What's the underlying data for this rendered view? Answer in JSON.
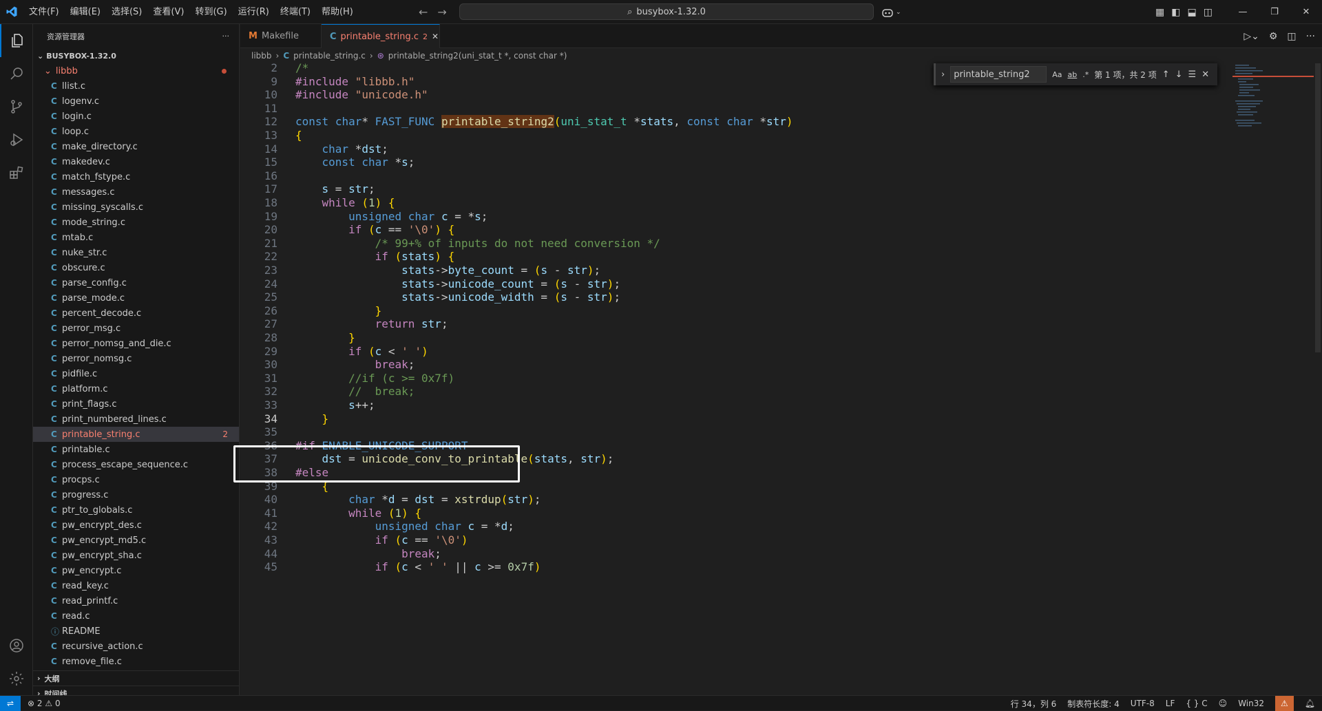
{
  "titlebar": {
    "menu": [
      "文件(F)",
      "编辑(E)",
      "选择(S)",
      "查看(V)",
      "转到(G)",
      "运行(R)",
      "终端(T)",
      "帮助(H)"
    ],
    "search_text": "busybox-1.32.0"
  },
  "sidebar": {
    "title": "资源管理器",
    "more": "···",
    "root": "BUSYBOX-1.32.0",
    "folder": "libbb",
    "files": [
      {
        "icon": "C",
        "name": "llist.c"
      },
      {
        "icon": "C",
        "name": "logenv.c"
      },
      {
        "icon": "C",
        "name": "login.c"
      },
      {
        "icon": "C",
        "name": "loop.c"
      },
      {
        "icon": "C",
        "name": "make_directory.c"
      },
      {
        "icon": "C",
        "name": "makedev.c"
      },
      {
        "icon": "C",
        "name": "match_fstype.c"
      },
      {
        "icon": "C",
        "name": "messages.c"
      },
      {
        "icon": "C",
        "name": "missing_syscalls.c"
      },
      {
        "icon": "C",
        "name": "mode_string.c"
      },
      {
        "icon": "C",
        "name": "mtab.c"
      },
      {
        "icon": "C",
        "name": "nuke_str.c"
      },
      {
        "icon": "C",
        "name": "obscure.c"
      },
      {
        "icon": "C",
        "name": "parse_config.c"
      },
      {
        "icon": "C",
        "name": "parse_mode.c"
      },
      {
        "icon": "C",
        "name": "percent_decode.c"
      },
      {
        "icon": "C",
        "name": "perror_msg.c"
      },
      {
        "icon": "C",
        "name": "perror_nomsg_and_die.c"
      },
      {
        "icon": "C",
        "name": "perror_nomsg.c"
      },
      {
        "icon": "C",
        "name": "pidfile.c"
      },
      {
        "icon": "C",
        "name": "platform.c"
      },
      {
        "icon": "C",
        "name": "print_flags.c"
      },
      {
        "icon": "C",
        "name": "print_numbered_lines.c"
      },
      {
        "icon": "C",
        "name": "printable_string.c",
        "badge": "2",
        "active": true
      },
      {
        "icon": "C",
        "name": "printable.c"
      },
      {
        "icon": "C",
        "name": "process_escape_sequence.c"
      },
      {
        "icon": "C",
        "name": "procps.c"
      },
      {
        "icon": "C",
        "name": "progress.c"
      },
      {
        "icon": "C",
        "name": "ptr_to_globals.c"
      },
      {
        "icon": "C",
        "name": "pw_encrypt_des.c"
      },
      {
        "icon": "C",
        "name": "pw_encrypt_md5.c"
      },
      {
        "icon": "C",
        "name": "pw_encrypt_sha.c"
      },
      {
        "icon": "C",
        "name": "pw_encrypt.c"
      },
      {
        "icon": "C",
        "name": "read_key.c"
      },
      {
        "icon": "C",
        "name": "read_printf.c"
      },
      {
        "icon": "C",
        "name": "read.c"
      },
      {
        "icon": "ⓘ",
        "name": "README"
      },
      {
        "icon": "C",
        "name": "recursive_action.c"
      },
      {
        "icon": "C",
        "name": "remove_file.c"
      }
    ],
    "outline": "大纲",
    "timeline": "时间线"
  },
  "tabs": [
    {
      "icon": "M",
      "label": "Makefile"
    },
    {
      "icon": "C",
      "label": "printable_string.c",
      "badge": "2",
      "close": "✕"
    }
  ],
  "breadcrumb": {
    "folder": "libbb",
    "file": "printable_string.c",
    "symbol": "printable_string2(uni_stat_t *, const char *)"
  },
  "find": {
    "query": "printable_string2",
    "opts": [
      "Aa",
      "ab",
      ".*"
    ],
    "result": "第 1 项，共 2 项"
  },
  "code": [
    {
      "n": "2",
      "t": "/*"
    },
    {
      "n": "9",
      "t": "#include \"libbb.h\""
    },
    {
      "n": "10",
      "t": "#include \"unicode.h\""
    },
    {
      "n": "11",
      "t": ""
    },
    {
      "n": "12",
      "t": "const char* FAST_FUNC printable_string2(uni_stat_t *stats, const char *str)"
    },
    {
      "n": "13",
      "t": "{"
    },
    {
      "n": "14",
      "t": "    char *dst;"
    },
    {
      "n": "15",
      "t": "    const char *s;"
    },
    {
      "n": "16",
      "t": ""
    },
    {
      "n": "17",
      "t": "    s = str;"
    },
    {
      "n": "18",
      "t": "    while (1) {"
    },
    {
      "n": "19",
      "t": "        unsigned char c = *s;"
    },
    {
      "n": "20",
      "t": "        if (c == '\\0') {"
    },
    {
      "n": "21",
      "t": "            /* 99+% of inputs do not need conversion */"
    },
    {
      "n": "22",
      "t": "            if (stats) {"
    },
    {
      "n": "23",
      "t": "                stats->byte_count = (s - str);"
    },
    {
      "n": "24",
      "t": "                stats->unicode_count = (s - str);"
    },
    {
      "n": "25",
      "t": "                stats->unicode_width = (s - str);"
    },
    {
      "n": "26",
      "t": "            }"
    },
    {
      "n": "27",
      "t": "            return str;"
    },
    {
      "n": "28",
      "t": "        }"
    },
    {
      "n": "29",
      "t": "        if (c < ' ')"
    },
    {
      "n": "30",
      "t": "            break;"
    },
    {
      "n": "31",
      "t": "        //if (c >= 0x7f)"
    },
    {
      "n": "32",
      "t": "        //  break;"
    },
    {
      "n": "33",
      "t": "        s++;"
    },
    {
      "n": "34",
      "t": "    }"
    },
    {
      "n": "35",
      "t": ""
    },
    {
      "n": "36",
      "t": "#if ENABLE_UNICODE_SUPPORT"
    },
    {
      "n": "37",
      "t": "    dst = unicode_conv_to_printable(stats, str);"
    },
    {
      "n": "38",
      "t": "#else"
    },
    {
      "n": "39",
      "t": "    {"
    },
    {
      "n": "40",
      "t": "        char *d = dst = xstrdup(str);"
    },
    {
      "n": "41",
      "t": "        while (1) {"
    },
    {
      "n": "42",
      "t": "            unsigned char c = *d;"
    },
    {
      "n": "43",
      "t": "            if (c == '\\0')"
    },
    {
      "n": "44",
      "t": "                break;"
    },
    {
      "n": "45",
      "t": "            if (c < ' ' || c >= 0x7f)"
    }
  ],
  "status": {
    "errors": "2",
    "warnings": "0",
    "position": "行 34，列 6",
    "indent": "制表符长度: 4",
    "encoding": "UTF-8",
    "eol": "LF",
    "language": "C",
    "platform": "Win32"
  },
  "colors": {
    "accent": "#0078d4",
    "error": "#f88070",
    "annotation": "#ffffff"
  }
}
